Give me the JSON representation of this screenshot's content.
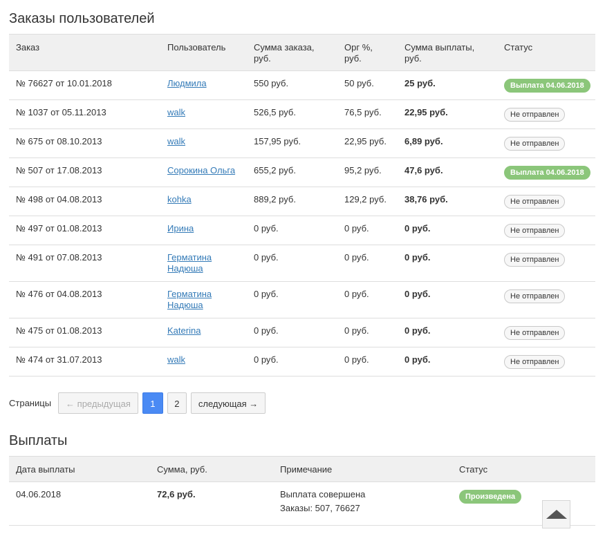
{
  "orders": {
    "title": "Заказы пользователей",
    "columns": [
      "Заказ",
      "Пользователь",
      "Сумма заказа, руб.",
      "Орг %, руб.",
      "Сумма выплаты, руб.",
      "Статус"
    ],
    "rows": [
      {
        "order": "№ 76627 от 10.01.2018",
        "user": "Людмила",
        "sum": "550 руб.",
        "org": "50 руб.",
        "payout": "25 руб.",
        "status": "Выплата 04.06.2018",
        "status_kind": "paid"
      },
      {
        "order": "№ 1037 от 05.11.2013",
        "user": "walk",
        "sum": "526,5 руб.",
        "org": "76,5 руб.",
        "payout": "22,95 руб.",
        "status": "Не отправлен",
        "status_kind": "notsent"
      },
      {
        "order": "№ 675 от 08.10.2013",
        "user": "walk",
        "sum": "157,95 руб.",
        "org": "22,95 руб.",
        "payout": "6,89 руб.",
        "status": "Не отправлен",
        "status_kind": "notsent"
      },
      {
        "order": "№ 507 от 17.08.2013",
        "user": "Сорокина Ольга",
        "sum": "655,2 руб.",
        "org": "95,2 руб.",
        "payout": "47,6 руб.",
        "status": "Выплата 04.06.2018",
        "status_kind": "paid"
      },
      {
        "order": "№ 498 от 04.08.2013",
        "user": "kohka",
        "sum": "889,2 руб.",
        "org": "129,2 руб.",
        "payout": "38,76 руб.",
        "status": "Не отправлен",
        "status_kind": "notsent"
      },
      {
        "order": "№ 497 от 01.08.2013",
        "user": "Ирина",
        "sum": "0 руб.",
        "org": "0 руб.",
        "payout": "0 руб.",
        "status": "Не отправлен",
        "status_kind": "notsent"
      },
      {
        "order": "№ 491 от 07.08.2013",
        "user": "Герматина Надюша",
        "sum": "0 руб.",
        "org": "0 руб.",
        "payout": "0 руб.",
        "status": "Не отправлен",
        "status_kind": "notsent"
      },
      {
        "order": "№ 476 от 04.08.2013",
        "user": "Герматина Надюша",
        "sum": "0 руб.",
        "org": "0 руб.",
        "payout": "0 руб.",
        "status": "Не отправлен",
        "status_kind": "notsent"
      },
      {
        "order": "№ 475 от 01.08.2013",
        "user": "Katerina",
        "sum": "0 руб.",
        "org": "0 руб.",
        "payout": "0 руб.",
        "status": "Не отправлен",
        "status_kind": "notsent"
      },
      {
        "order": "№ 474 от 31.07.2013",
        "user": "walk",
        "sum": "0 руб.",
        "org": "0 руб.",
        "payout": "0 руб.",
        "status": "Не отправлен",
        "status_kind": "notsent"
      }
    ]
  },
  "pagination": {
    "label": "Страницы",
    "prev": "← предыдущая",
    "pages": [
      "1",
      "2"
    ],
    "current": "1",
    "next": "следующая →"
  },
  "payments": {
    "title": "Выплаты",
    "columns": [
      "Дата выплаты",
      "Сумма, руб.",
      "Примечание",
      "Статус"
    ],
    "rows": [
      {
        "date": "04.06.2018",
        "amount": "72,6 руб.",
        "note": "Выплата совершена",
        "note_orders": "Заказы: 507, 76627",
        "status": "Произведена"
      }
    ]
  },
  "colors": {
    "accent": "#4a8af4",
    "link": "#337ab7",
    "paid_badge": "#8bc67a",
    "header_bg": "#f0f0f0"
  },
  "icons": {
    "scroll_top": "triangle-up-icon"
  }
}
